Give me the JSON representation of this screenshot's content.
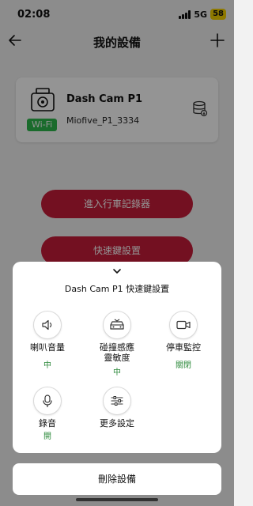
{
  "status": {
    "time": "02:08",
    "network": "5G",
    "battery": "58"
  },
  "nav": {
    "title": "我的設備"
  },
  "device": {
    "name": "Dash Cam P1",
    "serial": "Miofive_P1_3334",
    "connection": "Wi-Fi"
  },
  "buttons": {
    "enter_recorder": "進入行車記錄器",
    "quick_settings": "快速鍵設置"
  },
  "sheet": {
    "title": "Dash Cam P1 快速鍵設置",
    "tiles": [
      {
        "label": "喇叭音量",
        "value": "中",
        "icon": "speaker-icon"
      },
      {
        "label": "碰撞感應\n靈敏度",
        "value": "中",
        "icon": "collision-icon"
      },
      {
        "label": "停車監控",
        "value": "關閉",
        "icon": "video-camera-icon"
      },
      {
        "label": "錄音",
        "value": "開",
        "icon": "microphone-icon"
      },
      {
        "label": "更多設定",
        "value": "",
        "icon": "sliders-icon"
      }
    ]
  },
  "delete_button": "刪除設備",
  "colors": {
    "accent_red": "#c71c3a",
    "wifi_green": "#2db84d",
    "value_green": "#2e8a3c",
    "battery_yellow": "#f4d000"
  }
}
